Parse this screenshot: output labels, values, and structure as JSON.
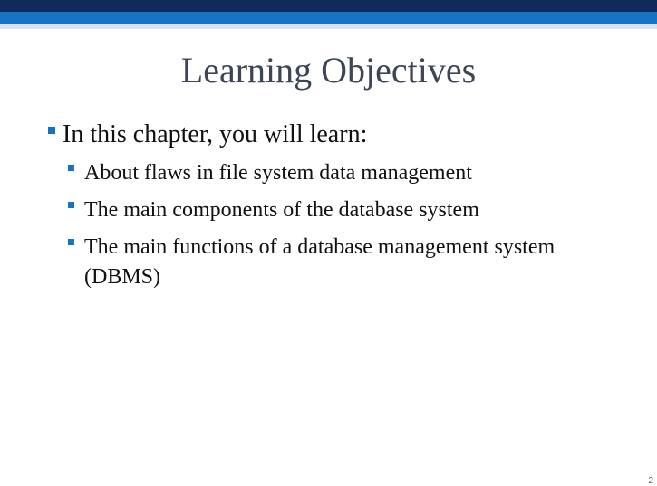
{
  "slide": {
    "title": "Learning Objectives",
    "main_bullet": "In this chapter, you will learn:",
    "sub_bullets": [
      "About flaws in file system data management",
      "The main components of the database system",
      "The main functions of a database management system (DBMS)"
    ],
    "page_number": "2"
  },
  "colors": {
    "header_dark": "#0f2a5c",
    "header_blue": "#1673c4",
    "header_light": "#d4e3f3",
    "bullet": "#1673c4",
    "title_text": "#3d4654"
  }
}
